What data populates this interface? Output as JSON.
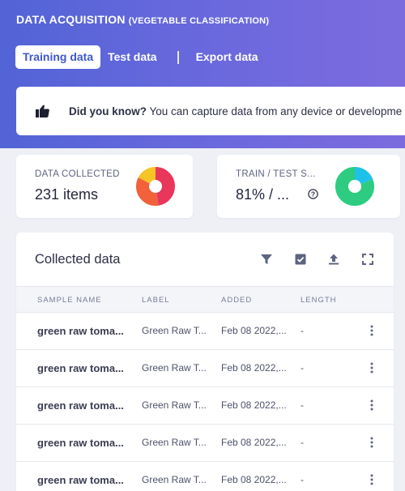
{
  "header": {
    "title": "DATA ACQUISITION",
    "subtitle": "(VEGETABLE CLASSIFICATION)"
  },
  "tabs": [
    {
      "label": "Training data",
      "active": true
    },
    {
      "label": "Test data",
      "active": false
    },
    {
      "label": "Export data",
      "active": false
    }
  ],
  "tip": {
    "icon": "thumbs-up-icon",
    "bold": "Did you know?",
    "text": " You can capture data from any device or developme"
  },
  "stats": {
    "collected": {
      "label": "DATA COLLECTED",
      "value": "231 items"
    },
    "split": {
      "label": "TRAIN / TEST S...",
      "value": "81% / ...",
      "help_icon": "question-circle-icon"
    }
  },
  "data_panel": {
    "title": "Collected data",
    "tools": [
      "filter-icon",
      "checkbox-icon",
      "upload-icon",
      "expand-icon"
    ],
    "columns": [
      "SAMPLE NAME",
      "LABEL",
      "ADDED",
      "LENGTH"
    ],
    "rows": [
      {
        "name": "green raw toma...",
        "label": "Green Raw T...",
        "added": "Feb 08 2022,...",
        "length": "-"
      },
      {
        "name": "green raw toma...",
        "label": "Green Raw T...",
        "added": "Feb 08 2022,...",
        "length": "-"
      },
      {
        "name": "green raw toma...",
        "label": "Green Raw T...",
        "added": "Feb 08 2022,...",
        "length": "-"
      },
      {
        "name": "green raw toma...",
        "label": "Green Raw T...",
        "added": "Feb 08 2022,...",
        "length": "-"
      },
      {
        "name": "green raw toma...",
        "label": "Green Raw T...",
        "added": "Feb 08 2022,...",
        "length": "-"
      }
    ]
  },
  "colors": {
    "header_gradient_start": "#5264d6",
    "header_gradient_end": "#7c6bdf",
    "active_tab_text": "#3e59c9",
    "donut_collected": [
      "#e8375a",
      "#f2613a",
      "#f7c425"
    ],
    "donut_split": [
      "#2ecc80",
      "#1fc1e8"
    ]
  }
}
